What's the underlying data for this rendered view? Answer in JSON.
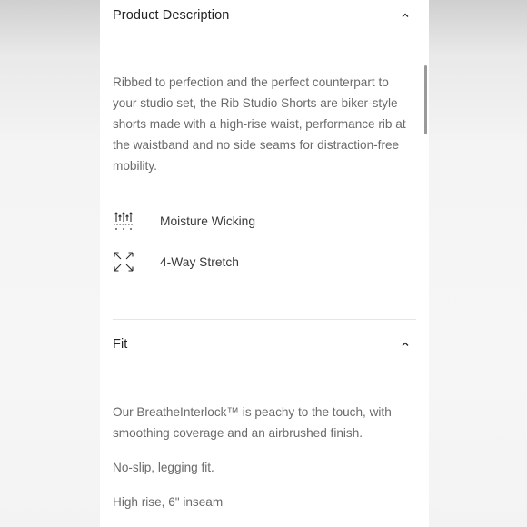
{
  "description_section": {
    "title": "Product Description",
    "body": "Ribbed to perfection and the perfect counterpart to your studio set, the Rib Studio Shorts are biker-style shorts made with a high-rise waist, performance rib at the waistband and no side seams for distraction-free mobility.",
    "features": [
      {
        "icon": "moisture-wicking-icon",
        "label": "Moisture Wicking"
      },
      {
        "icon": "four-way-stretch-icon",
        "label": "4-Way Stretch"
      }
    ]
  },
  "fit_section": {
    "title": "Fit",
    "paragraphs": [
      "Our BreatheInterlock™ is peachy to the touch, with smoothing coverage and an airbrushed finish.",
      "No-slip, legging fit.",
      "High rise, 6\" inseam"
    ]
  }
}
